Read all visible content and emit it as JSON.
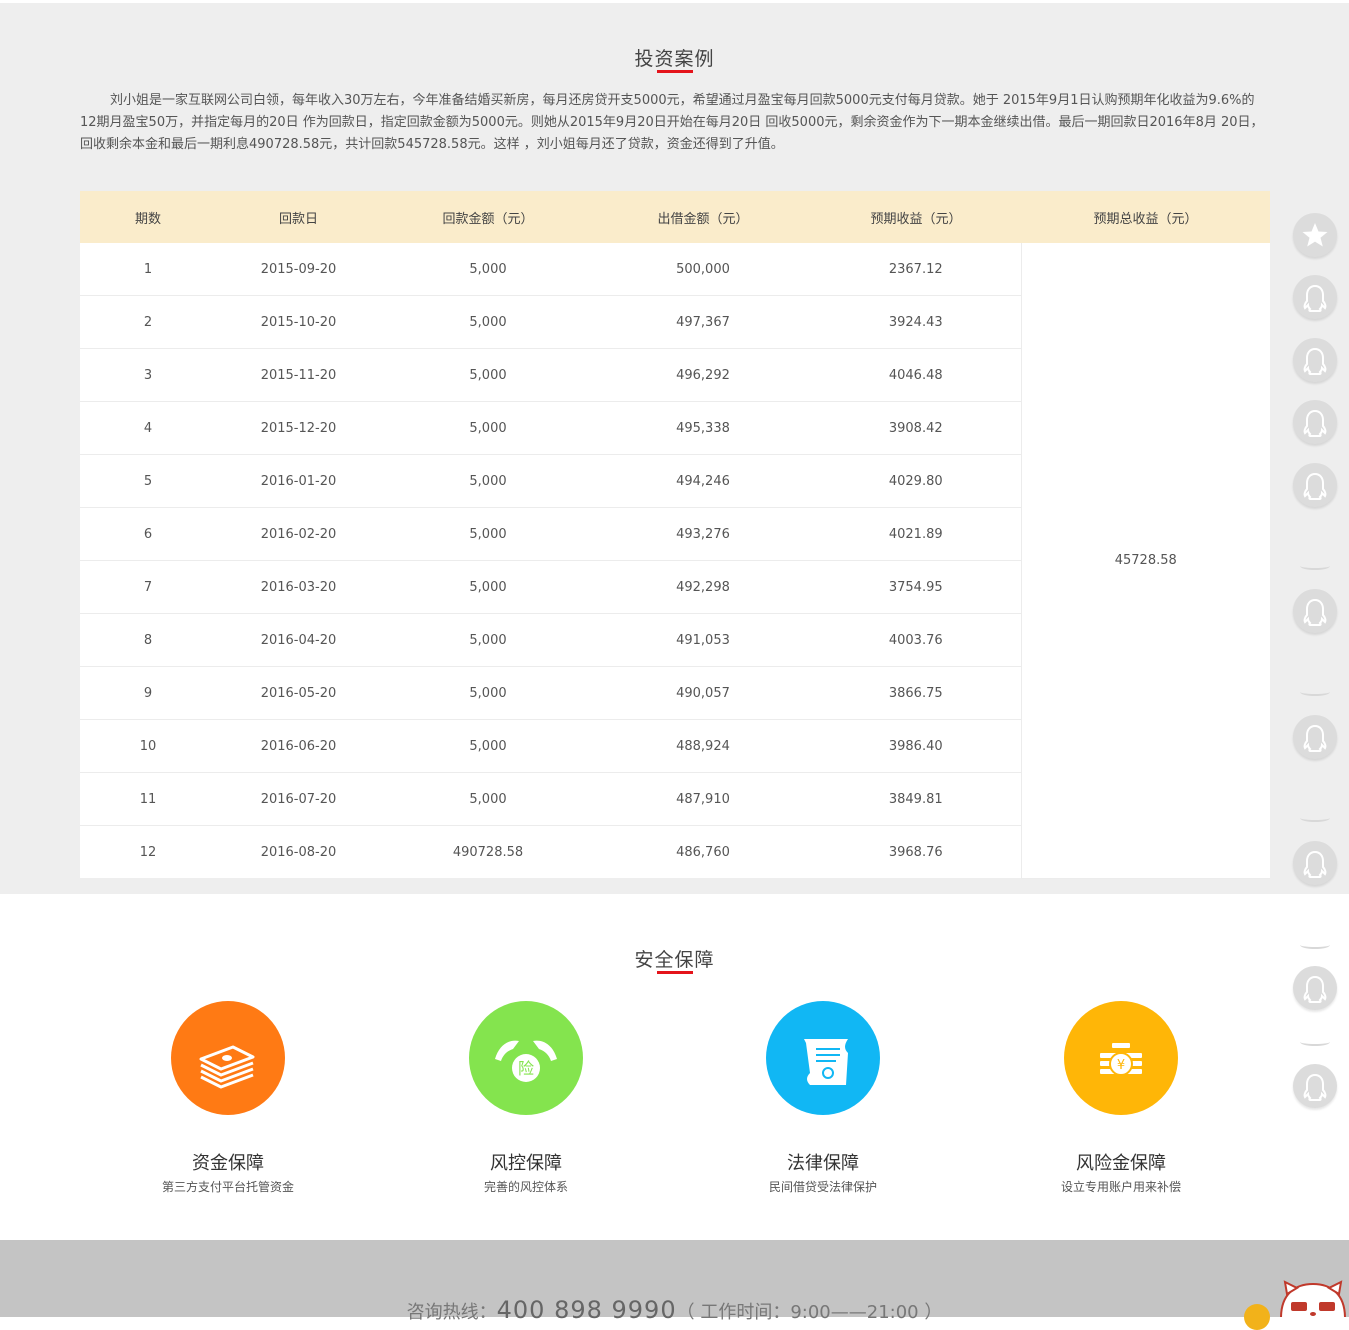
{
  "case_section": {
    "title": "投资案例",
    "description": "刘小姐是一家互联网公司白领，每年收入30万左右，今年准备结婚买新房，每月还房贷开支5000元，希望通过月盈宝每月回款5000元支付每月贷款。她于 2015年9月1日认购预期年化收益为9.6%的12期月盈宝50万，并指定每月的20日 作为回款日，指定回款金额为5000元。则她从2015年9月20日开始在每月20日 回收5000元，剩余资金作为下一期本金继续出借。最后一期回款日2016年8月 20日，回收剩余本金和最后一期利息490728.58元，共计回款545728.58元。这样 ，刘小姐每月还了贷款，资金还得到了升值。",
    "table": {
      "headers": [
        "期数",
        "回款日",
        "回款金额（元）",
        "出借金额（元）",
        "预期收益（元）",
        "预期总收益（元）"
      ],
      "rows": [
        [
          "1",
          "2015-09-20",
          "5,000",
          "500,000",
          "2367.12"
        ],
        [
          "2",
          "2015-10-20",
          "5,000",
          "497,367",
          "3924.43"
        ],
        [
          "3",
          "2015-11-20",
          "5,000",
          "496,292",
          "4046.48"
        ],
        [
          "4",
          "2015-12-20",
          "5,000",
          "495,338",
          "3908.42"
        ],
        [
          "5",
          "2016-01-20",
          "5,000",
          "494,246",
          "4029.80"
        ],
        [
          "6",
          "2016-02-20",
          "5,000",
          "493,276",
          "4021.89"
        ],
        [
          "7",
          "2016-03-20",
          "5,000",
          "492,298",
          "3754.95"
        ],
        [
          "8",
          "2016-04-20",
          "5,000",
          "491,053",
          "4003.76"
        ],
        [
          "9",
          "2016-05-20",
          "5,000",
          "490,057",
          "3866.75"
        ],
        [
          "10",
          "2016-06-20",
          "5,000",
          "488,924",
          "3986.40"
        ],
        [
          "11",
          "2016-07-20",
          "5,000",
          "487,910",
          "3849.81"
        ],
        [
          "12",
          "2016-08-20",
          "490728.58",
          "486,760",
          "3968.76"
        ]
      ],
      "total": "45728.58"
    }
  },
  "security_section": {
    "title": "安全保障",
    "features": [
      {
        "title": "资金保障",
        "subtitle": "第三方支付平台托管资金",
        "icon": "money-stack-icon",
        "color": "#ff7a14"
      },
      {
        "title": "风控保障",
        "subtitle": "完善的风控体系",
        "icon": "shield-hands-icon",
        "color": "#84e44e",
        "icon_text": "险"
      },
      {
        "title": "法律保障",
        "subtitle": "民间借贷受法律保护",
        "icon": "certificate-icon",
        "color": "#11b7f4"
      },
      {
        "title": "风险金保障",
        "subtitle": "设立专用账户用来补偿",
        "icon": "coin-stack-icon",
        "color": "#ffb607",
        "icon_text": "¥"
      }
    ]
  },
  "sidebar": {
    "buttons": [
      "star-icon",
      "qq-icon",
      "qq-icon",
      "qq-icon",
      "qq-icon",
      "qq-icon",
      "qq-icon",
      "qq-icon",
      "qq-icon",
      "qq-icon"
    ]
  },
  "footer": {
    "hotline_label": "咨询热线：",
    "hotline_number": "400 898 9990",
    "hours": "（ 工作时间：9:00——21:00 ）"
  }
}
